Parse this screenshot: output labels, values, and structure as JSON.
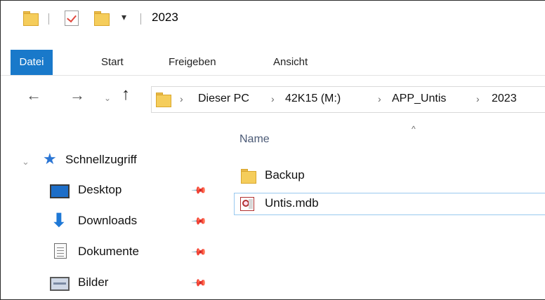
{
  "window": {
    "title": "2023"
  },
  "quick_access_toolbar": {
    "dropdown": "▾"
  },
  "ribbon": {
    "tabs": [
      {
        "label": "Datei",
        "active": true
      },
      {
        "label": "Start"
      },
      {
        "label": "Freigeben"
      },
      {
        "label": "Ansicht"
      }
    ],
    "accent_color": "#1979ca"
  },
  "nav": {
    "back": "←",
    "forward": "→",
    "recent": "⌄",
    "up": "↑"
  },
  "address_bar": {
    "breadcrumbs": [
      "Dieser PC",
      "42K15 (M:)",
      "APP_Untis",
      "2023"
    ],
    "separator": "›"
  },
  "sidebar": {
    "quick_access": "Schnellzugriff",
    "items": [
      {
        "label": "Desktop",
        "icon": "desktop-icon"
      },
      {
        "label": "Downloads",
        "icon": "downloads-icon"
      },
      {
        "label": "Dokumente",
        "icon": "documents-icon"
      },
      {
        "label": "Bilder",
        "icon": "pictures-icon"
      }
    ],
    "pin_glyph": "📌"
  },
  "file_list": {
    "column_name": "Name",
    "sort_glyph": "^",
    "items": [
      {
        "name": "Backup",
        "type": "folder"
      },
      {
        "name": "Untis.mdb",
        "type": "access-database",
        "selected": true
      }
    ]
  }
}
